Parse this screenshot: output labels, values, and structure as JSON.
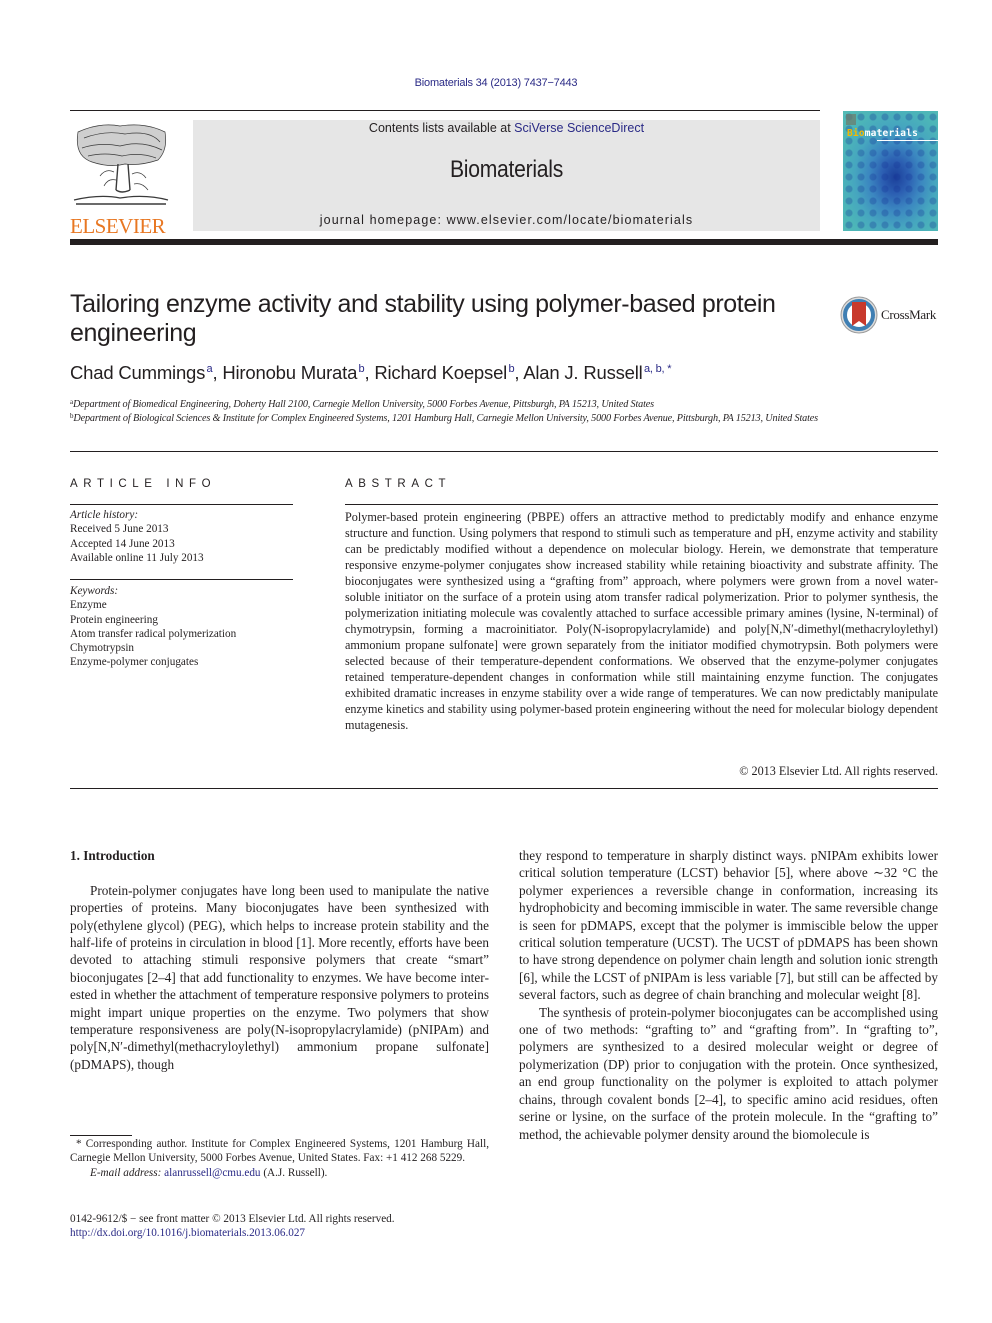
{
  "header": {
    "journal_ref": "Biomaterials 34 (2013) 7437−7443",
    "contents_prefix": "Contents lists available at ",
    "contents_link": "SciVerse ScienceDirect",
    "journal_name": "Biomaterials",
    "homepage": "journal homepage: www.elsevier.com/locate/biomaterials",
    "publisher_logo": "ELSEVIER",
    "cover_title_highlight": "Bio",
    "cover_title_rest": "materials"
  },
  "article": {
    "title": "Tailoring enzyme activity and stability using polymer-based protein engineering",
    "crossmark_label": "CrossMark",
    "authors": [
      {
        "name": "Chad Cummings",
        "sup": "a",
        "sep": ", "
      },
      {
        "name": "Hironobu Murata",
        "sup": "b",
        "sep": ", "
      },
      {
        "name": "Richard Koepsel",
        "sup": "b",
        "sep": ", "
      },
      {
        "name": "Alan J. Russell",
        "sup": "a, b, *",
        "sep": ""
      }
    ],
    "affiliations": [
      {
        "label": "a",
        "text": "Department of Biomedical Engineering, Doherty Hall 2100, Carnegie Mellon University, 5000 Forbes Avenue, Pittsburgh, PA 15213, United States"
      },
      {
        "label": "b",
        "text": "Department of Biological Sciences & Institute for Complex Engineered Systems, 1201 Hamburg Hall, Carnegie Mellon University, 5000 Forbes Avenue, Pittsburgh, PA 15213, United States"
      }
    ]
  },
  "article_info": {
    "heading": "ARTICLE INFO",
    "history_label": "Article history:",
    "history": [
      "Received 5 June 2013",
      "Accepted 14 June 2013",
      "Available online 11 July 2013"
    ],
    "keywords_label": "Keywords:",
    "keywords": [
      "Enzyme",
      "Protein engineering",
      "Atom transfer radical polymerization",
      "Chymotrypsin",
      "Enzyme-polymer conjugates"
    ]
  },
  "abstract": {
    "heading": "ABSTRACT",
    "text": "Polymer-based protein engineering (PBPE) offers an attractive method to predictably modify and enhance enzyme structure and function. Using polymers that respond to stimuli such as temperature and pH, enzyme activity and stability can be predictably modified without a dependence on molecular biology. Herein, we demonstrate that temperature responsive enzyme-polymer conjugates show increased stability while retaining bioactivity and substrate affinity. The bioconjugates were synthesized using a “grafting from” approach, where polymers were grown from a novel water-soluble initiator on the surface of a protein using atom transfer radical polymerization. Prior to polymer synthesis, the polymerization initiating molecule was covalently attached to surface accessible primary amines (lysine, N-terminal) of chymotrypsin, forming a macroinitiator. Poly(N-isopropylacrylamide) and poly[N,N′-dimethyl(methacryloylethyl) ammonium propane sulfonate] were grown separately from the initiator modified chymotrypsin. Both polymers were selected because of their temperature-dependent confor­mations. We observed that the enzyme-polymer conjugates retained temperature-dependent changes in conformation while still maintaining enzyme function. The conjugates exhibited dramatic increases in enzyme stability over a wide range of temperatures. We can now predictably manipulate enzyme ki­netics and stability using polymer-based protein engineering without the need for molecular biology dependent mutagenesis.",
    "copyright": "© 2013 Elsevier Ltd. All rights reserved."
  },
  "body": {
    "section_heading": "1.  Introduction",
    "left_para_1": "Protein-polymer conjugates have long been used to manipulate the native properties of proteins. Many bioconjugates have been synthesized with poly(ethylene glycol) (PEG), which helps to in­crease protein stability and the half-life of proteins in circulation in blood [1]. More recently, efforts have been devoted to attaching stimuli responsive polymers that create “smart” bioconjugates [2–4] that add functionality to enzymes. We have become inter­ested in whether the attachment of temperature responsive poly­mers to proteins might impart unique properties on the enzyme. Two polymers that show temperature responsiveness are poly(N-isopropylacrylamide) (pNIPAm) and poly[N,N′-dimethyl(metha­cryloylethyl) ammonium propane sulfonate] (pDMAPS), though",
    "right_para_1": "they respond to temperature in sharply distinct ways. pNIPAm exhibits lower critical solution temperature (LCST) behavior [5], where above ∼32 °C the polymer experiences a reversible change in conformation, increasing its hydrophobicity and becoming immiscible in water. The same reversible change is seen for pDMAPS, except that the polymer is immiscible below the upper critical solution temperature (UCST). The UCST of pDMAPS has been shown to have strong dependence on polymer chain length and solution ionic strength [6], while the LCST of pNIPAm is less variable [7], but still can be affected by several factors, such as degree of chain branching and molecular weight [8].",
    "right_para_2": "The synthesis of protein-polymer bioconjugates can be accom­plished using one of two methods: “grafting to” and “grafting from”. In “grafting to”, polymers are synthesized to a desired mo­lecular weight or degree of polymerization (DP) prior to conjuga­tion with the protein. Once synthesized, an end group functionality on the polymer is exploited to attach polymer chains, through co­valent bonds [2–4], to specific amino acid residues, often serine or lysine, on the surface of the protein molecule. In the “grafting to” method, the achievable polymer density around the biomolecule is"
  },
  "footnote": {
    "corresponding": "* Corresponding author. Institute for Complex Engineered Systems, 1201 Hamburg Hall, Carnegie Mellon University, 5000 Forbes Avenue, United States. Fax: +1 412 268 5229.",
    "email_label": "E-mail address: ",
    "email": "alanrussell@cmu.edu",
    "email_suffix": " (A.J. Russell)."
  },
  "front_matter": {
    "issn_line": "0142-9612/$ − see front matter © 2013 Elsevier Ltd. All rights reserved.",
    "doi": "http://dx.doi.org/10.1016/j.biomaterials.2013.06.027"
  },
  "colors": {
    "link": "#2a2a86",
    "elsevier_orange": "#e87722",
    "header_gray": "#e6e6e6",
    "crossmark_red": "#c8392c"
  }
}
